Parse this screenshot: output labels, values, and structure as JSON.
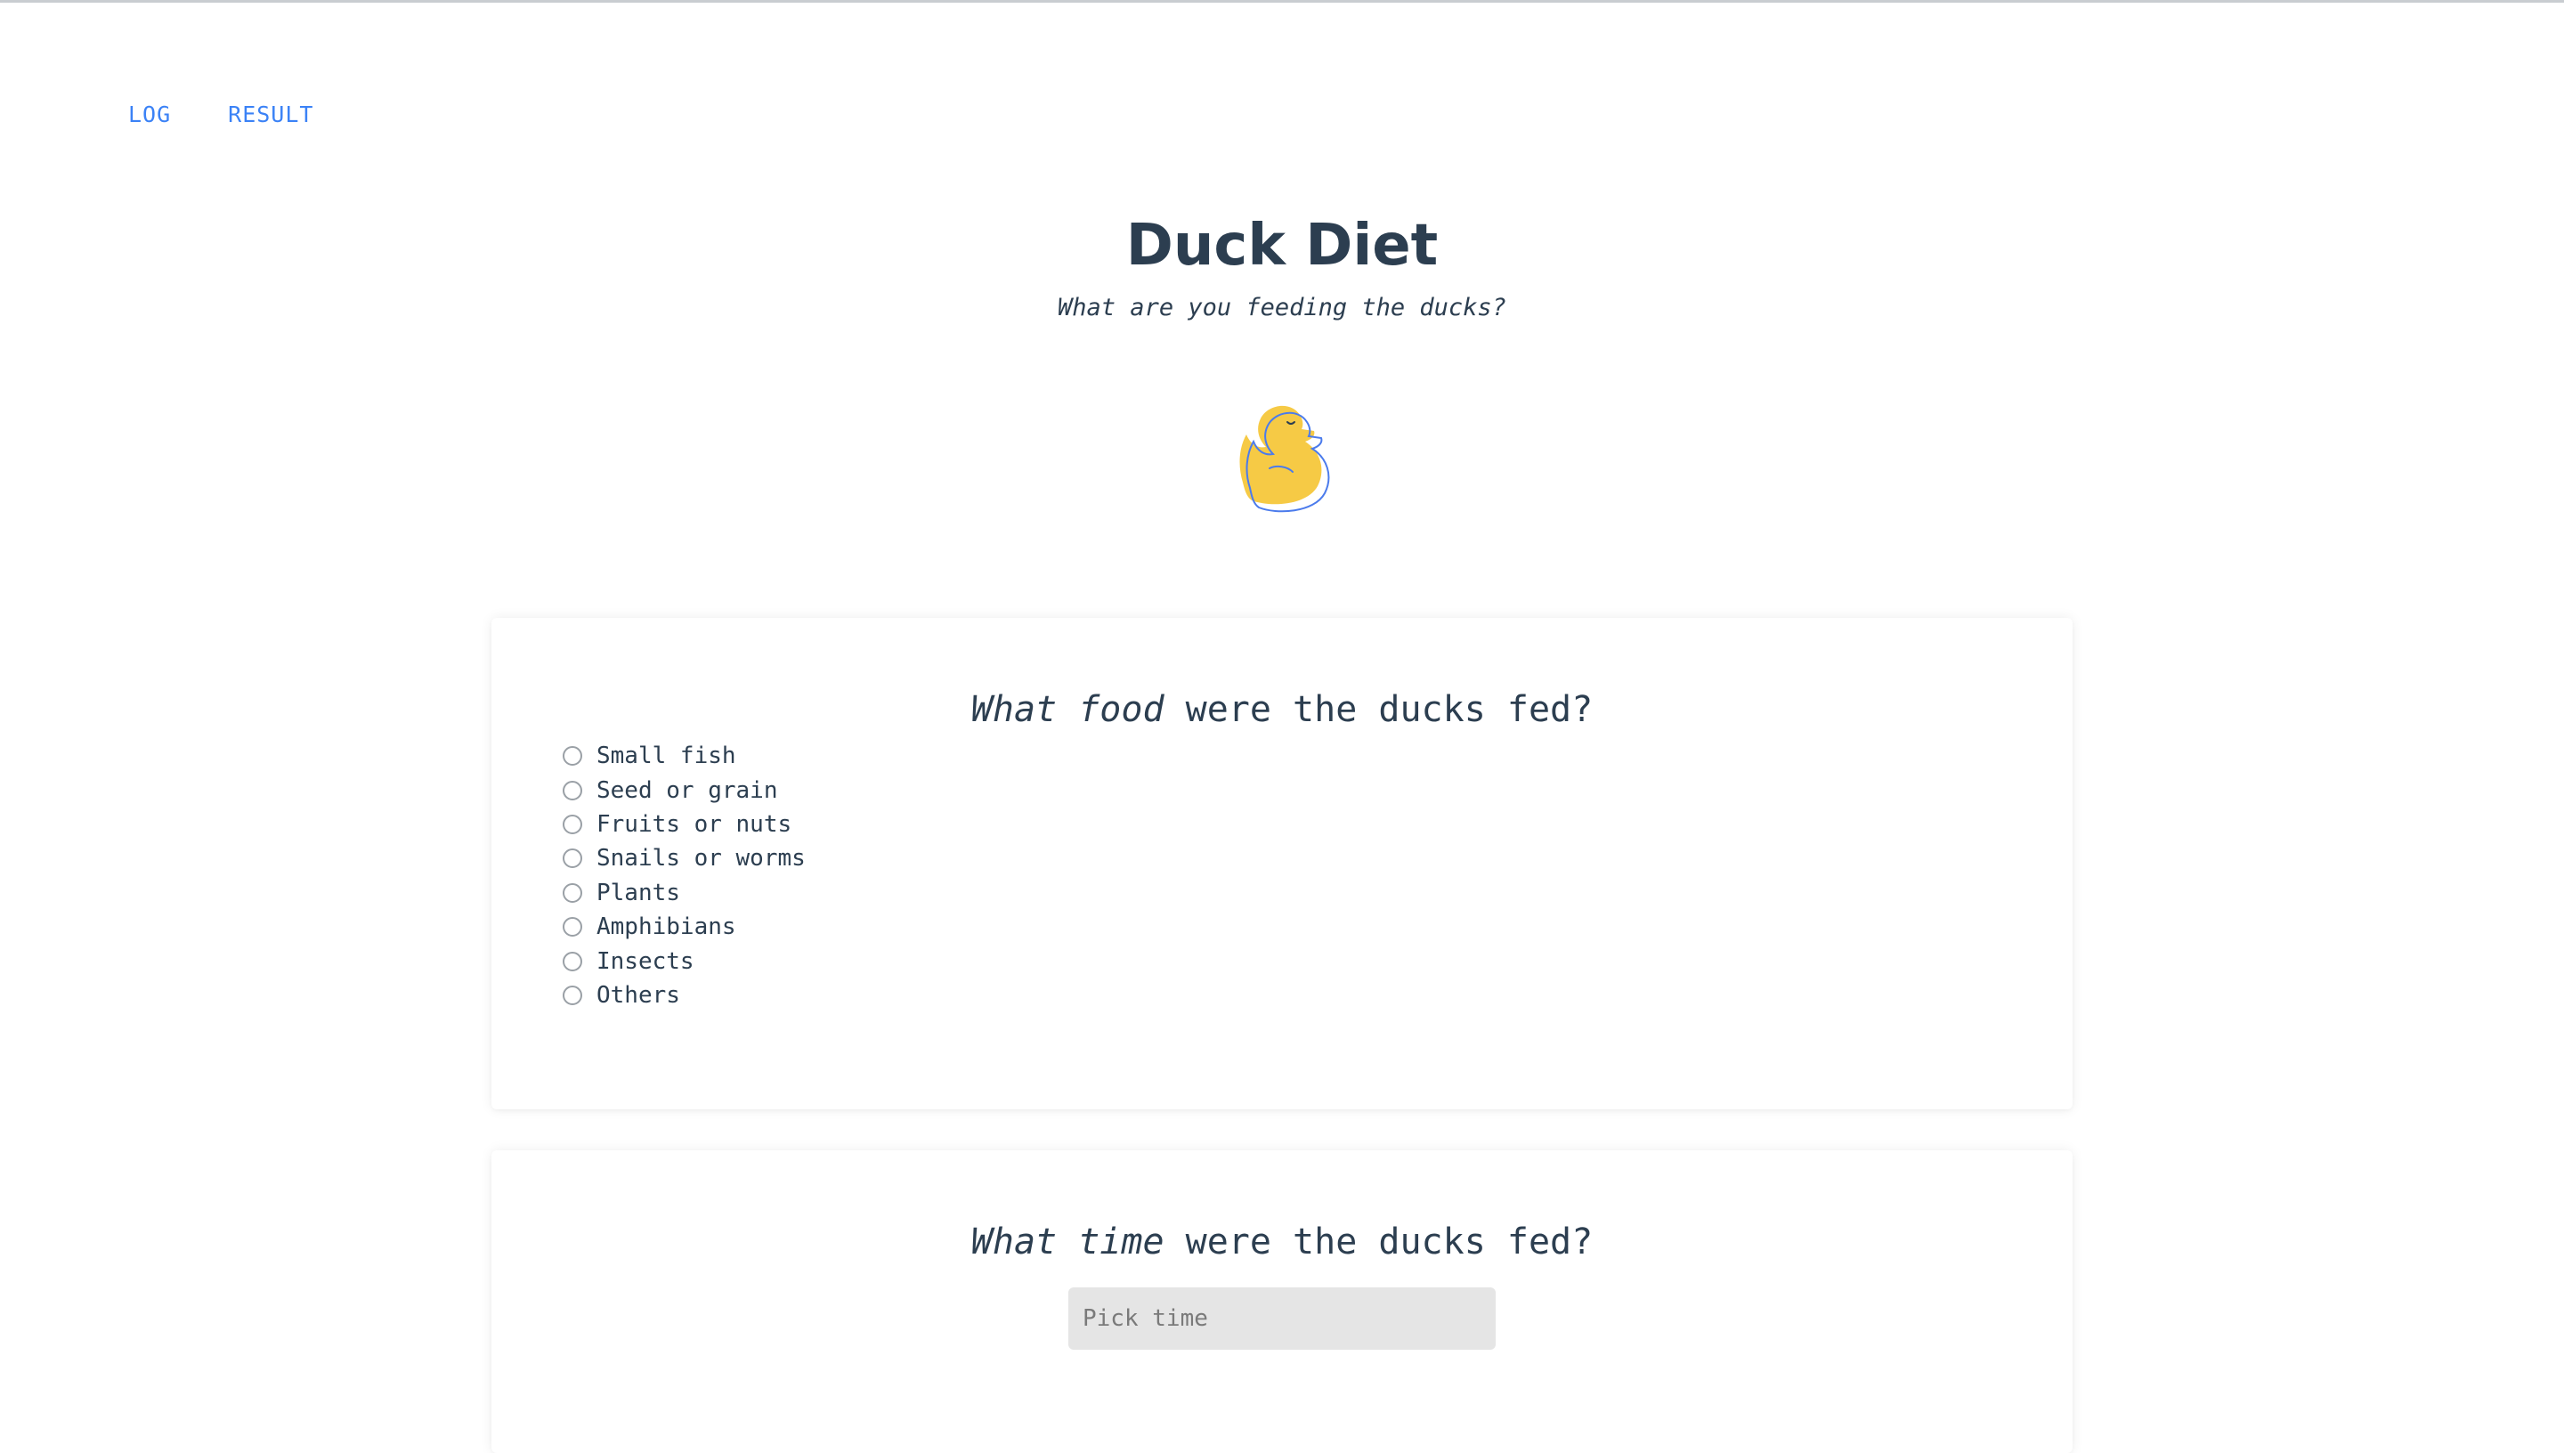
{
  "nav": {
    "items": [
      {
        "label": "LOG"
      },
      {
        "label": "RESULT"
      }
    ]
  },
  "header": {
    "title": "Duck Diet",
    "subtitle": "What are you feeding the ducks?",
    "logo_icon": "duck-icon"
  },
  "food_question": {
    "emphasis": "What food",
    "rest": " were the ducks fed?",
    "options": [
      {
        "label": "Small fish"
      },
      {
        "label": "Seed or grain"
      },
      {
        "label": "Fruits or nuts"
      },
      {
        "label": "Snails or worms"
      },
      {
        "label": "Plants"
      },
      {
        "label": "Amphibians"
      },
      {
        "label": "Insects"
      },
      {
        "label": "Others"
      }
    ]
  },
  "time_question": {
    "emphasis": "What time",
    "rest": " were the ducks fed?",
    "placeholder": "Pick time",
    "value": ""
  },
  "colors": {
    "accent": "#3b82f6",
    "text": "#2c3e50",
    "duck_fill": "#f6ca45",
    "duck_outline": "#4b7bec",
    "input_bg": "#e5e5e5"
  }
}
